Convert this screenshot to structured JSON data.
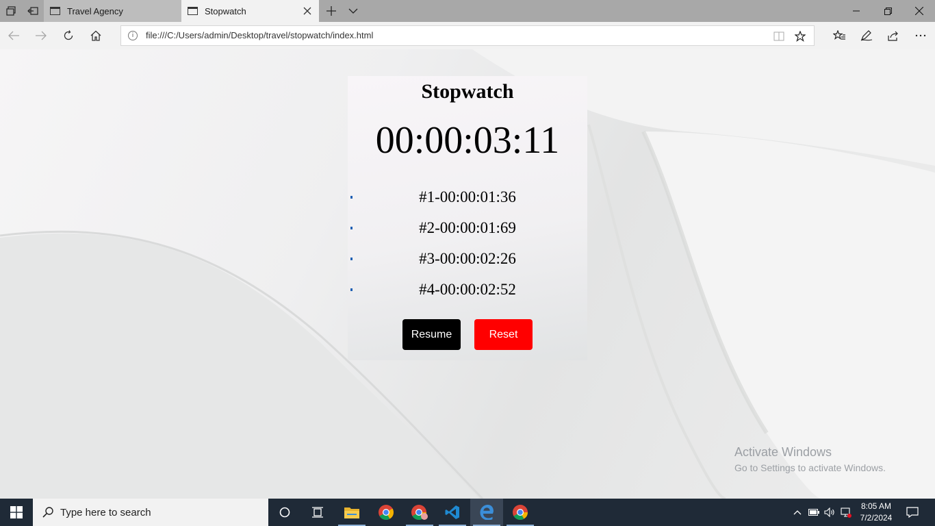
{
  "browser": {
    "tabs": [
      {
        "label": "Travel Agency",
        "active": false
      },
      {
        "label": "Stopwatch",
        "active": true
      }
    ],
    "url": "file:///C:/Users/admin/Desktop/travel/stopwatch/index.html"
  },
  "page": {
    "title": "Stopwatch",
    "display": "00:00:03:11",
    "laps": [
      "#1-00:00:01:36",
      "#2-00:00:01:69",
      "#3-00:00:02:26",
      "#4-00:00:02:52"
    ],
    "buttons": {
      "resume": "Resume",
      "reset": "Reset"
    },
    "colors": {
      "resume": "#000000",
      "reset": "#ff0000"
    }
  },
  "watermark": {
    "line1": "Activate Windows",
    "line2": "Go to Settings to activate Windows."
  },
  "taskbar": {
    "search_placeholder": "Type here to search",
    "time": "8:05 AM",
    "date": "7/2/2024"
  }
}
